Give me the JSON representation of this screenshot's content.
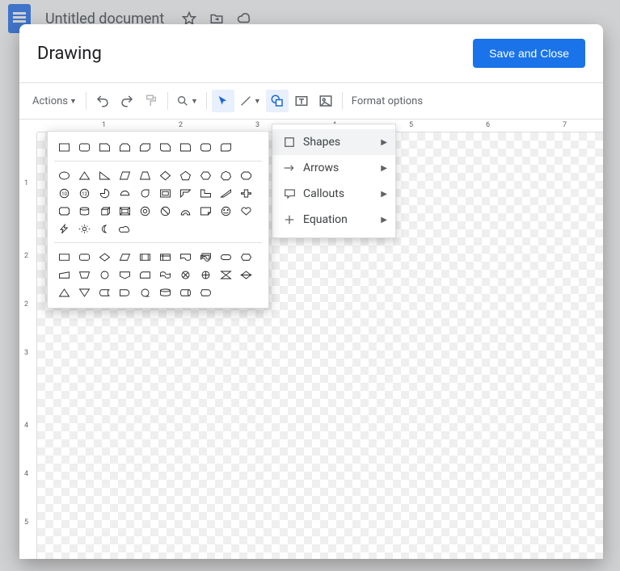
{
  "header": {
    "doc_title": "Untitled document"
  },
  "dialog": {
    "title": "Drawing",
    "save_label": "Save and Close"
  },
  "toolbar": {
    "actions_label": "Actions",
    "format_label": "Format options"
  },
  "ruler": {
    "h_ticks": [
      "1",
      "2",
      "3",
      "4",
      "5",
      "6",
      "7"
    ],
    "v_ticks": [
      "1",
      "2",
      "2",
      "3",
      "4",
      "4",
      "5"
    ]
  },
  "shape_menu": {
    "items": [
      {
        "label": "Shapes",
        "icon": "square-icon"
      },
      {
        "label": "Arrows",
        "icon": "arrow-right-icon"
      },
      {
        "label": "Callouts",
        "icon": "callout-icon"
      },
      {
        "label": "Equation",
        "icon": "plus-icon"
      }
    ]
  },
  "shape_groups": [
    {
      "name": "rectangles",
      "shapes": [
        "rect",
        "round-rect",
        "snip-1",
        "snip-2",
        "snip-diag",
        "snip-round",
        "round-1",
        "round-2",
        "round-diag"
      ]
    },
    {
      "name": "basic",
      "shapes": [
        "oval",
        "triangle",
        "right-tri",
        "parallelogram",
        "trapezoid",
        "diamond",
        "pentagon",
        "hexagon",
        "heptagon",
        "octagon",
        "decagon",
        "dodecagon",
        "pie",
        "chord",
        "teardrop",
        "frame",
        "half-frame",
        "l-shape",
        "diag-stripe",
        "cross",
        "plaque",
        "can",
        "cube",
        "bevel",
        "donut",
        "no-symbol",
        "block-arc",
        "fold-corner",
        "smiley",
        "heart",
        "lightning",
        "sun",
        "moon",
        "cloud"
      ]
    },
    {
      "name": "flowchart",
      "shapes": [
        "process",
        "alt-process",
        "decision",
        "data",
        "predef",
        "internal",
        "document",
        "multidoc",
        "terminator",
        "prep",
        "manual-in",
        "manual-op",
        "connector",
        "offpage",
        "card",
        "tape",
        "sum-junc",
        "or",
        "collate",
        "sort",
        "extract",
        "merge",
        "stored",
        "delay",
        "seq-access",
        "mag-disk",
        "direct",
        "display"
      ]
    }
  ]
}
